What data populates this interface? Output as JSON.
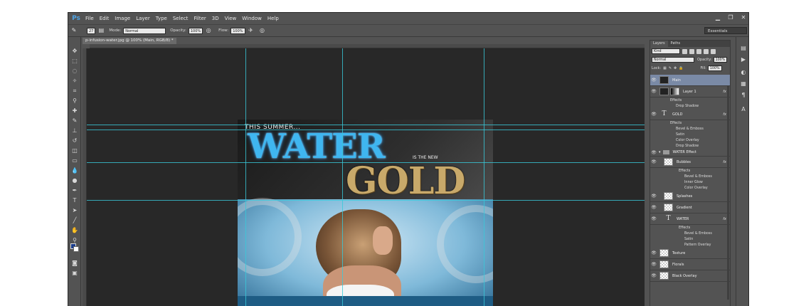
{
  "menubar": {
    "logo": "Ps",
    "items": [
      "File",
      "Edit",
      "Image",
      "Layer",
      "Type",
      "Select",
      "Filter",
      "3D",
      "View",
      "Window",
      "Help"
    ]
  },
  "options": {
    "brush_size": "27",
    "mode_label": "Mode:",
    "mode_value": "Normal",
    "opacity_label": "Opacity:",
    "opacity_value": "100%",
    "flow_label": "Flow:",
    "flow_value": "100%",
    "workspace": "Essentials"
  },
  "document": {
    "tab_title": "p-infusion-water.jpg @ 100% (Main, RGB/8) *"
  },
  "artwork": {
    "line1": "THIS SUMMER...",
    "water": "WATER",
    "is_the_new": "IS THE NEW",
    "gold": "GOLD"
  },
  "layers_panel": {
    "tab_layers": "Layers",
    "tab_paths": "Paths",
    "filter_kind": "Kind",
    "blend_mode": "Normal",
    "opacity_label": "Opacity:",
    "opacity_value": "100%",
    "lock_label": "Lock:",
    "fill_label": "Fill:",
    "fill_value": "100%",
    "layers": {
      "main": "Main",
      "layer1": "Layer 1",
      "layer1_effects": "Effects",
      "layer1_fx1": "Drop Shadow",
      "gold": "GOLD",
      "gold_effects": "Effects",
      "gold_fx1": "Bevel & Emboss",
      "gold_fx2": "Satin",
      "gold_fx3": "Color Overlay",
      "gold_fx4": "Drop Shadow",
      "water_group": "WATER Effect",
      "bubbles": "Bubbles",
      "bubbles_effects": "Effects",
      "bubbles_fx1": "Bevel & Emboss",
      "bubbles_fx2": "Inner Glow",
      "bubbles_fx3": "Color Overlay",
      "splashes": "Splashes",
      "gradient": "Gradient",
      "water": "WATER",
      "water_effects": "Effects",
      "water_fx1": "Bevel & Emboss",
      "water_fx2": "Satin",
      "water_fx3": "Pattern Overlay",
      "texture": "Texture",
      "florals": "Florals",
      "black_overlay": "Black Overlay"
    },
    "fx_badge": "fx"
  }
}
